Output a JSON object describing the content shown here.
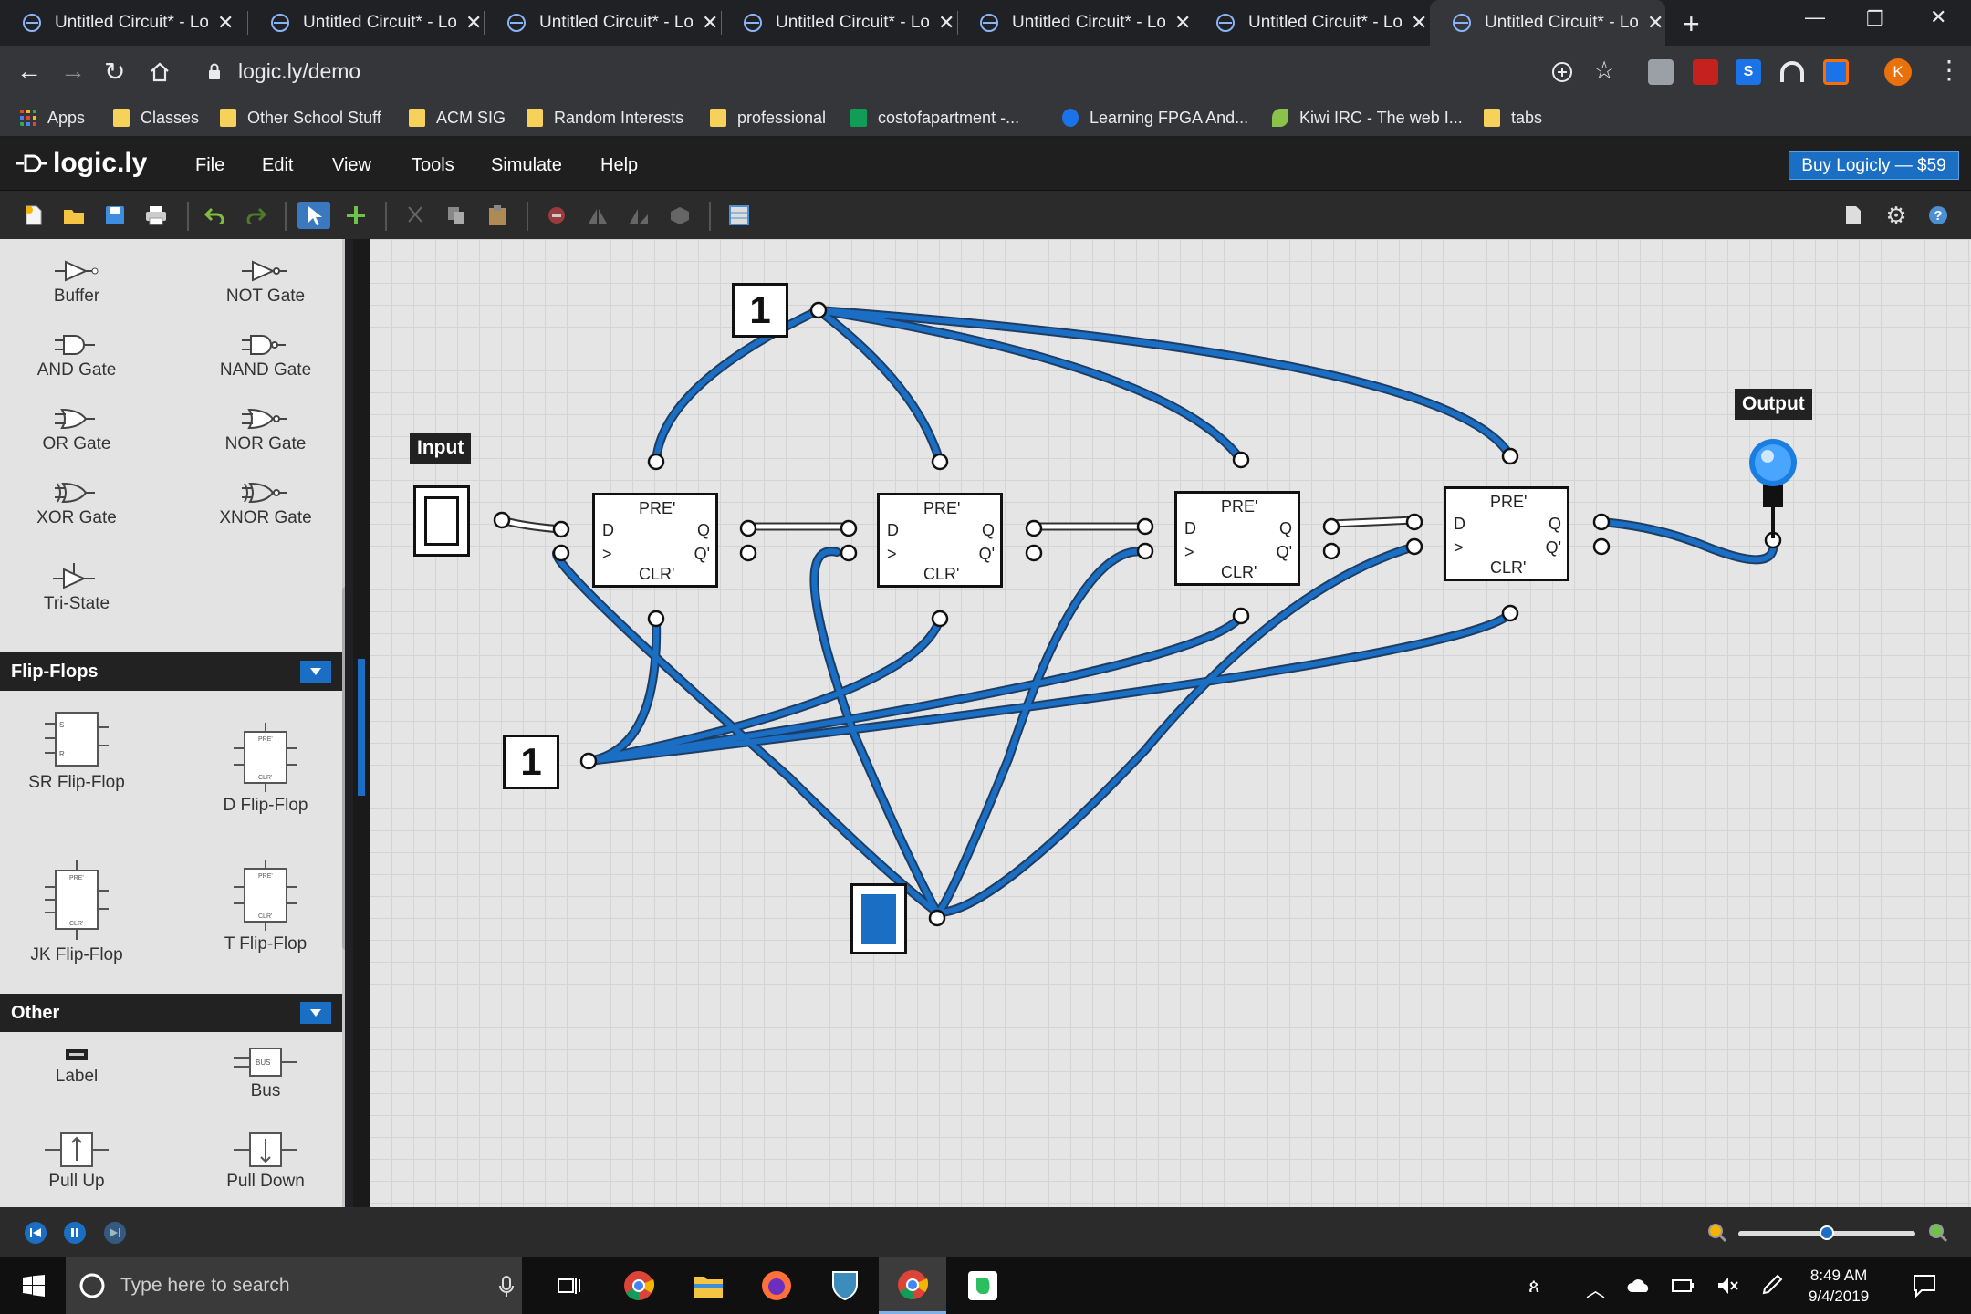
{
  "browser": {
    "tabs": [
      {
        "title": "Untitled Circuit* - Lo",
        "active": false
      },
      {
        "title": "Untitled Circuit* - Lo",
        "active": false
      },
      {
        "title": "Untitled Circuit* - Lo",
        "active": false
      },
      {
        "title": "Untitled Circuit* - Lo",
        "active": false
      },
      {
        "title": "Untitled Circuit* - Lo",
        "active": false
      },
      {
        "title": "Untitled Circuit* - Lo",
        "active": false
      },
      {
        "title": "Untitled Circuit* - Lo",
        "active": true
      }
    ],
    "url": "logic.ly/demo",
    "profile_initial": "K",
    "bookmarks": [
      "Apps",
      "Classes",
      "Other School Stuff",
      "ACM SIG",
      "Random Interests",
      "professional",
      "costofapartment -...",
      "Learning FPGA And...",
      "Kiwi IRC - The web I...",
      "tabs"
    ]
  },
  "app": {
    "logo": "logic.ly",
    "menu": [
      "File",
      "Edit",
      "View",
      "Tools",
      "Simulate",
      "Help"
    ],
    "buy_button": "Buy Logicly — $59"
  },
  "sidebar": {
    "gates": [
      "Buffer",
      "NOT Gate",
      "AND Gate",
      "NAND Gate",
      "OR Gate",
      "NOR Gate",
      "XOR Gate",
      "XNOR Gate",
      "Tri-State"
    ],
    "flipflops_title": "Flip-Flops",
    "flipflops": [
      "SR Flip-Flop",
      "D Flip-Flop",
      "JK Flip-Flop",
      "T Flip-Flop"
    ],
    "other_title": "Other",
    "other": [
      "Label",
      "Bus",
      "Pull Up",
      "Pull Down"
    ]
  },
  "circuit": {
    "input_label": "Input",
    "output_label": "Output",
    "constant_top": "1",
    "constant_left": "1",
    "flipflop": {
      "pre": "PRE'",
      "clr": "CLR'",
      "d": "D",
      "clk": ">",
      "q": "Q",
      "qn": "Q'"
    }
  },
  "taskbar": {
    "search_placeholder": "Type here to search",
    "time": "8:49 AM",
    "date": "9/4/2019"
  },
  "colors": {
    "accent": "#1a6fc4",
    "wire": "#1a6fc4",
    "canvas": "#e5e5e5"
  }
}
